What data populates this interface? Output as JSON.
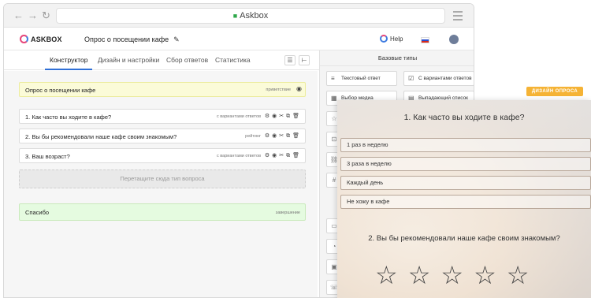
{
  "browser": {
    "url": "Askbox",
    "back_icon": "arrow-left-icon",
    "forward_icon": "arrow-right-icon",
    "reload_icon": "reload-icon",
    "menu_icon": "hamburger-icon"
  },
  "app": {
    "logo": "ASKBOX",
    "survey_title": "Опрос о посещении кафе",
    "help": "Help",
    "language_flag": "ru-flag-icon"
  },
  "tabs": [
    "Конструктор",
    "Дизайн и настройки",
    "Сбор ответов",
    "Статистика"
  ],
  "editor": {
    "welcome": {
      "text": "Опрос о посещении кафе",
      "type": "приветствие"
    },
    "questions": [
      {
        "text": "1. Как часто вы ходите в кафе?",
        "type": "с вариантами ответов"
      },
      {
        "text": "2. Вы бы рекомендовали наше кафе своим знакомым?",
        "type": "рейтинг"
      },
      {
        "text": "3. Ваш возраст?",
        "type": "с вариантами ответов"
      }
    ],
    "dropzone": "Перетащите сюда тип вопроса",
    "thanks": {
      "text": "Спасибо",
      "type": "завершение"
    }
  },
  "types_panel": {
    "title": "Базовые типы",
    "buttons": [
      "Текстовый ответ",
      "С вариантами ответов",
      "Выбор медиа",
      "Выпадающий список"
    ]
  },
  "design_badge": "ДИЗАЙН ОПРОСА",
  "preview": {
    "q1": "1. Как часто вы ходите в кафе?",
    "options": [
      "1 раз в неделю",
      "3 раза в неделю",
      "Каждый день",
      "Не хожу в кафе"
    ],
    "q2": "2. Вы бы рекомендовали наше кафе своим знакомым?",
    "rating_stars": 5
  },
  "colors": {
    "accent": "#2f6fd6",
    "welcome_bg": "#fbfbd8",
    "thanks_bg": "#e5fbe0",
    "badge": "#f5b335"
  }
}
